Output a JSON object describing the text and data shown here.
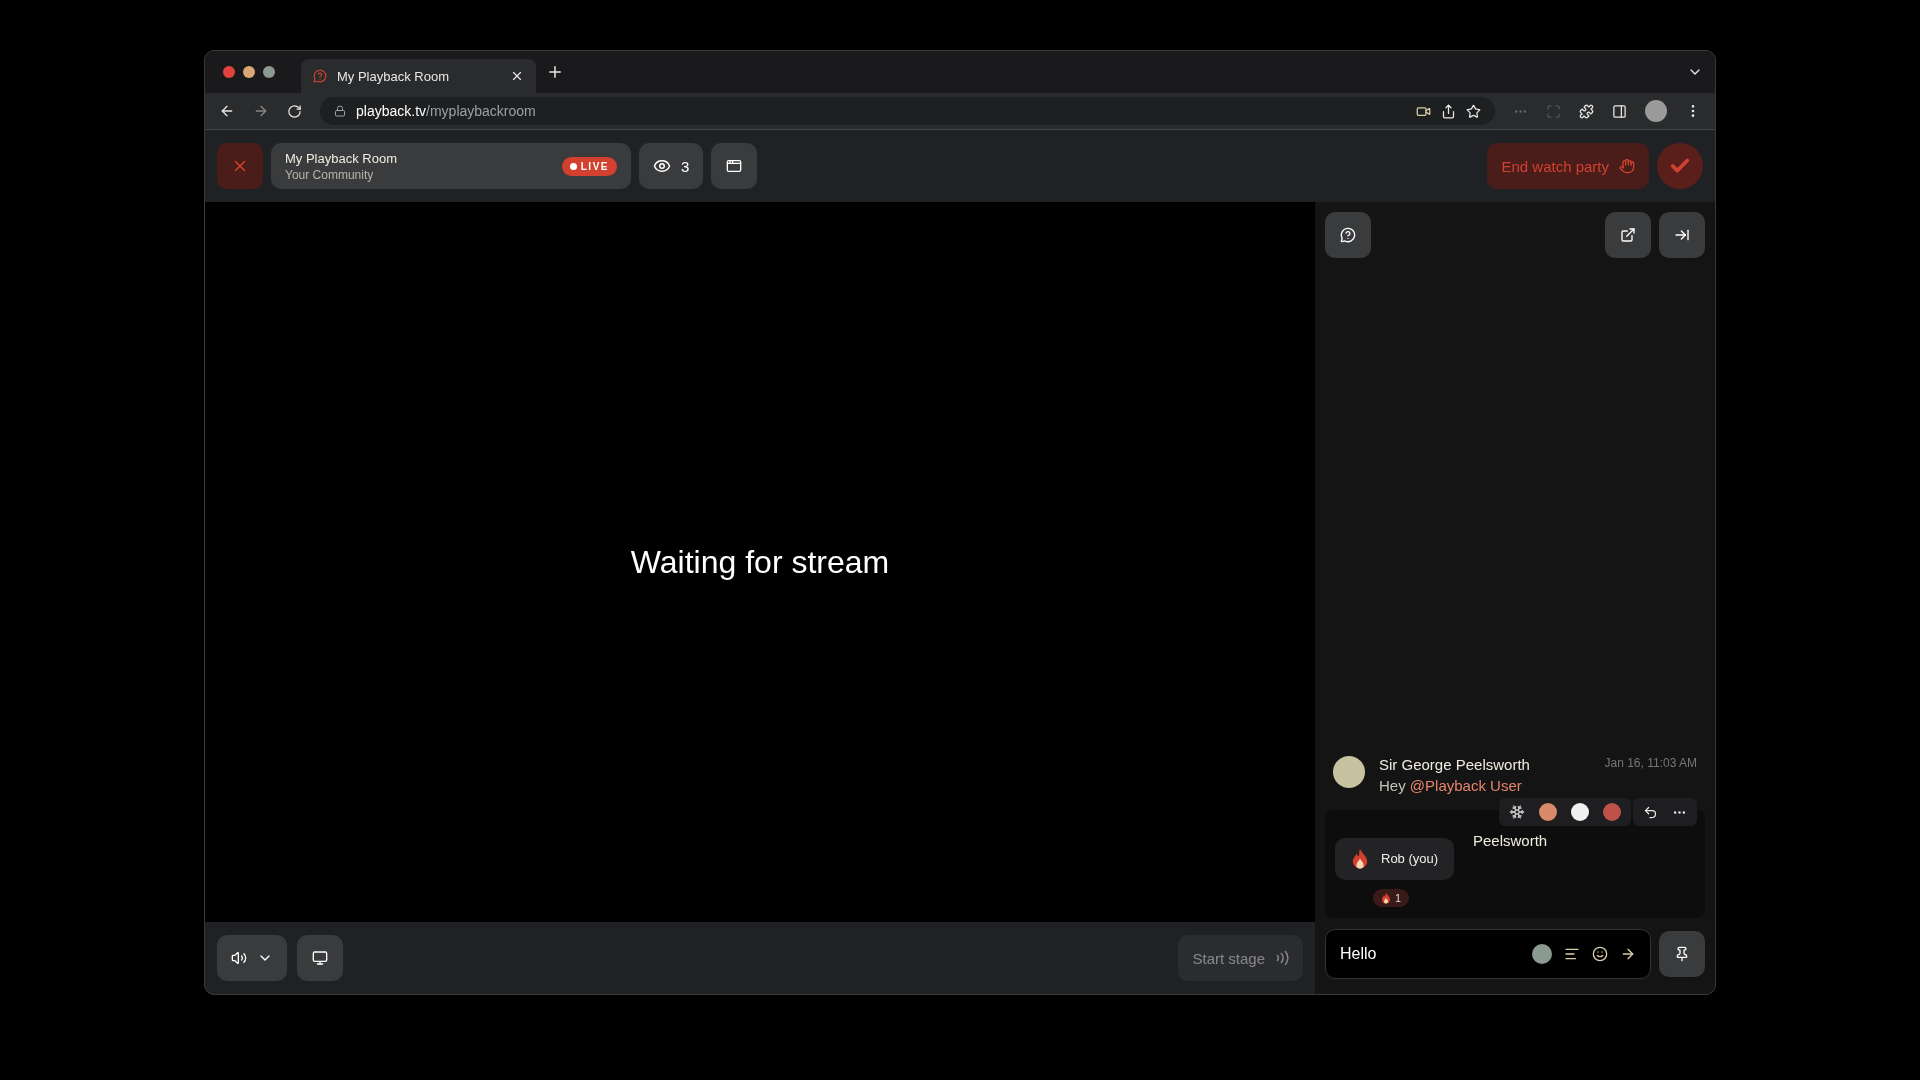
{
  "browser": {
    "tab": {
      "title": "My Playback Room"
    },
    "url": {
      "host": "playback.tv",
      "path": "/myplaybackroom"
    }
  },
  "room": {
    "name": "My Playback Room",
    "community": "Your Community",
    "live_badge": "LIVE",
    "viewers": "3"
  },
  "end_button": "End watch party",
  "stage": {
    "message": "Waiting for stream"
  },
  "start_stage": {
    "label": "Start stage",
    "disabled": true
  },
  "chat": {
    "messages": [
      {
        "author": "Sir George Peelsworth",
        "time": "Jan 16, 11:03 AM",
        "text": "Hey ",
        "mention": "@Playback User",
        "hovered": false
      },
      {
        "author": "Peelsworth",
        "hovered": true,
        "reactions": [
          {
            "count": "1"
          }
        ]
      }
    ],
    "tooltip": "Rob (you)",
    "input": {
      "value": "Hello"
    }
  }
}
